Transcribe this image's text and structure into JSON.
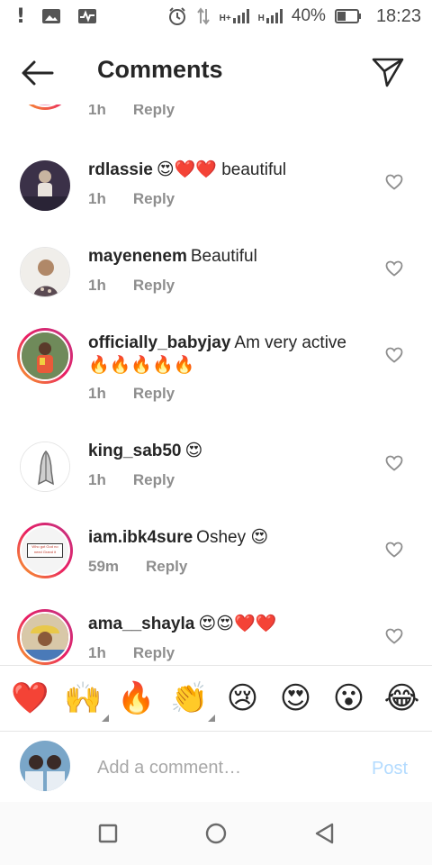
{
  "status_bar": {
    "battery": "40%",
    "time": "18:23",
    "net1": "H+",
    "net2": "H"
  },
  "header": {
    "title": "Comments"
  },
  "partial_row": {
    "time": "1h",
    "reply": "Reply"
  },
  "comments": [
    {
      "username": "rdlassie",
      "text": "😍❤️❤️ beautiful",
      "time": "1h",
      "reply": "Reply"
    },
    {
      "username": "mayenenem",
      "text": "Beautiful",
      "time": "1h",
      "reply": "Reply"
    },
    {
      "username": "officially_babyjay",
      "text": "Am very active 🔥🔥🔥🔥🔥",
      "time": "1h",
      "reply": "Reply"
    },
    {
      "username": "king_sab50",
      "text": "😍",
      "time": "1h",
      "reply": "Reply"
    },
    {
      "username": "iam.ibk4sure",
      "text": "Oshey 😍",
      "time": "59m",
      "reply": "Reply",
      "avatar_text": "Who got God no need Grand it"
    },
    {
      "username": "ama__shayla",
      "text": "😍😍❤️❤️",
      "time": "1h",
      "reply": "Reply"
    }
  ],
  "emoji_bar": [
    "❤️",
    "🙌",
    "🔥",
    "👏",
    "😢",
    "😍",
    "😮",
    "😂"
  ],
  "composer": {
    "placeholder": "Add a comment…",
    "post_label": "Post"
  },
  "colors": {
    "text": "#262626",
    "muted": "#8e8e8e",
    "post_disabled": "#b3dbff",
    "like_icon": "#8e8e8e"
  }
}
